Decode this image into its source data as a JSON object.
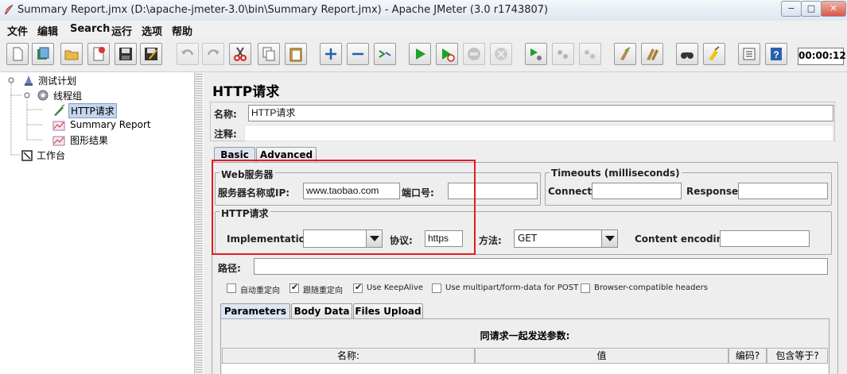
{
  "window": {
    "title": "Summary Report.jmx (D:\\apache-jmeter-3.0\\bin\\Summary Report.jmx) - Apache JMeter (3.0 r1743807)",
    "controls": {
      "minimize": "−",
      "maximize": "□",
      "close": "✕"
    }
  },
  "menu": [
    "文件",
    "编辑",
    "Search",
    "运行",
    "选项",
    "帮助"
  ],
  "toolbar": {
    "timer": "00:00:12",
    "icons": [
      "new-icon",
      "templates-icon",
      "open-icon",
      "close-icon",
      "save-icon",
      "save-as-icon",
      "undo-icon",
      "redo-icon",
      "cut-icon",
      "copy-icon",
      "paste-icon",
      "expand-icon",
      "collapse-icon",
      "toggle-icon",
      "start-icon",
      "start-no-pause-icon",
      "stop-icon",
      "shutdown-icon",
      "remote-start-icon",
      "remote-stop-icon",
      "remote-shutdown-icon",
      "clear-icon",
      "clear-all-icon",
      "search-icon",
      "reset-search-icon",
      "function-helper-icon",
      "help-icon"
    ]
  },
  "tree": {
    "items": [
      {
        "label": "测试计划",
        "icon": "test-plan-icon"
      },
      {
        "label": "线程组",
        "icon": "thread-group-icon"
      },
      {
        "label": "HTTP请求",
        "icon": "http-sampler-icon",
        "selected": true
      },
      {
        "label": "Summary Report",
        "icon": "listener-icon"
      },
      {
        "label": "图形结果",
        "icon": "listener-icon"
      },
      {
        "label": "工作台",
        "icon": "workbench-icon"
      }
    ]
  },
  "panel": {
    "title": "HTTP请求",
    "name_label": "名称:",
    "name_value": "HTTP请求",
    "comment_label": "注释:",
    "comment_value": "",
    "tabs": [
      "Basic",
      "Advanced"
    ],
    "web_server": {
      "title": "Web服务器",
      "server_label": "服务器名称或IP:",
      "server_value": "www.taobao.com",
      "port_label": "端口号:",
      "port_value": ""
    },
    "timeouts": {
      "title": "Timeouts (milliseconds)",
      "connect_label": "Connect:",
      "connect_value": "",
      "response_label": "Response:",
      "response_value": ""
    },
    "http_request": {
      "title": "HTTP请求",
      "implementation_label": "Implementation:",
      "implementation_value": "",
      "protocol_label": "协议:",
      "protocol_value": "https",
      "method_label": "方法:",
      "method_value": "GET",
      "encoding_label": "Content encoding:",
      "encoding_value": ""
    },
    "path_label": "路径:",
    "path_value": "",
    "options": [
      {
        "label": "自动重定向",
        "checked": false
      },
      {
        "label": "跟随重定向",
        "checked": true
      },
      {
        "label": "Use KeepAlive",
        "checked": true
      },
      {
        "label": "Use multipart/form-data for POST",
        "checked": false
      },
      {
        "label": "Browser-compatible headers",
        "checked": false
      }
    ],
    "sub_tabs": [
      "Parameters",
      "Body Data",
      "Files Upload"
    ],
    "params_caption": "同请求一起发送参数:",
    "columns": [
      "名称:",
      "值",
      "编码?",
      "包含等于?"
    ]
  }
}
